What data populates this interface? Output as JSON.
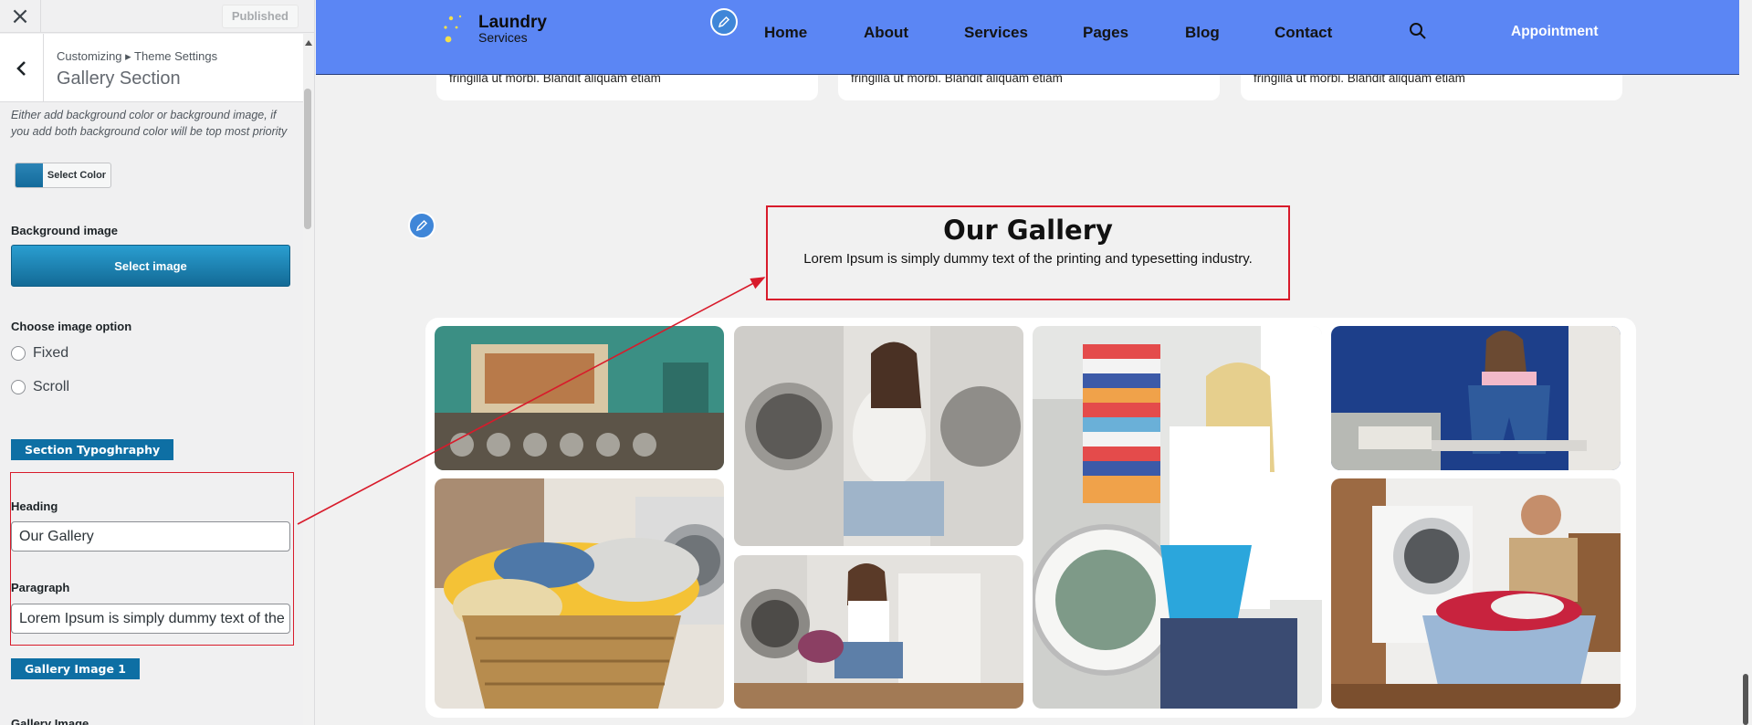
{
  "sidebar": {
    "close_icon": "×",
    "published_label": "Published",
    "breadcrumb": "Customizing ▸ Theme Settings",
    "section_title": "Gallery Section",
    "bg_note": "Either add background color or background image, if you add both background color will be top most priority",
    "select_color_label": "Select Color",
    "bg_image_label": "Background image",
    "select_image_label": "Select image",
    "image_option_label": "Choose image option",
    "radio_fixed": "Fixed",
    "radio_scroll": "Scroll",
    "section_typography_tag": "Section Typoghraphy",
    "heading_label": "Heading",
    "heading_value": "Our Gallery",
    "paragraph_label": "Paragraph",
    "paragraph_value": "Lorem Ipsum is simply dummy text of the printing and typesetting industry.",
    "gallery_image_tag": "Gallery Image 1",
    "gallery_image_label": "Gallery Image"
  },
  "preview": {
    "logo_line1": "Laundry",
    "logo_line2": "Services",
    "menu": [
      "Home",
      "About",
      "Services",
      "Pages",
      "Blog",
      "Contact"
    ],
    "appointment_label": "Appointment",
    "card_text": "fringilla ut morbi. Blandit aliquam etiam",
    "gallery_title": "Our Gallery",
    "gallery_paragraph": "Lorem Ipsum is simply dummy text of the printing and typesetting industry."
  },
  "colors": {
    "nav_bg": "#5b86f4",
    "accent_button": "#0e6fa4",
    "highlight_red": "#d81b2b"
  },
  "icons": [
    "close-icon",
    "back-arrow-icon",
    "pencil-icon",
    "search-icon",
    "logo-icon"
  ]
}
